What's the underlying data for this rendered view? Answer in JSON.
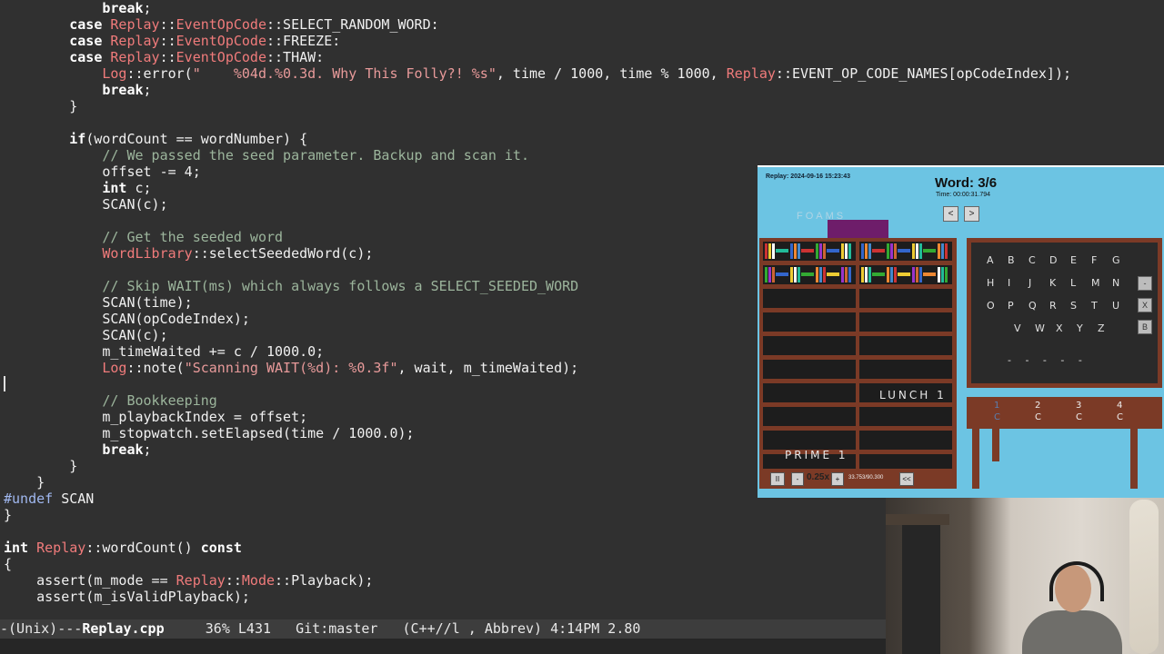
{
  "editor": {
    "lines": [
      {
        "y": 0
      },
      {
        "y": 1
      }
    ]
  },
  "modeline": {
    "prefix": "-(Unix)---",
    "filename": "Replay.cpp",
    "position": "     36% L431",
    "vcs": "   Git:master",
    "modes": "   (C++//l , Abbrev)",
    "time": " 4:14PM",
    "load": " 2.80"
  },
  "game": {
    "replay_label": "Replay: 2024-09-16 15:23:43",
    "word_label": "Word: 3/6",
    "time_label": "Time: 00:00:31.794",
    "prev_button": "<",
    "next_button": ">",
    "foams_text": "FOAMS",
    "shelf_label_lunch": "LUNCH  1",
    "shelf_label_prime": "PRIME  1",
    "pause_button": "II",
    "minus_button": "-",
    "speed": "0.25x",
    "plus_button": "+",
    "progress": "33.753/90.300",
    "rewind_button": "<<",
    "letters_row1": [
      "A",
      "B",
      "C",
      "D",
      "E",
      "F",
      "G"
    ],
    "letters_row2": [
      "H",
      "I",
      "J",
      "K",
      "L",
      "M",
      "N"
    ],
    "letters_row3": [
      "O",
      "P",
      "Q",
      "R",
      "S",
      "T",
      "U"
    ],
    "letters_row4": [
      "V",
      "W",
      "X",
      "Y",
      "Z"
    ],
    "blanks": "- - - - -",
    "side_buttons": [
      "-",
      "X",
      "B"
    ],
    "table_numbers": [
      "1",
      "2",
      "3",
      "4"
    ],
    "table_letters": [
      "C",
      "C",
      "C",
      "C"
    ]
  }
}
